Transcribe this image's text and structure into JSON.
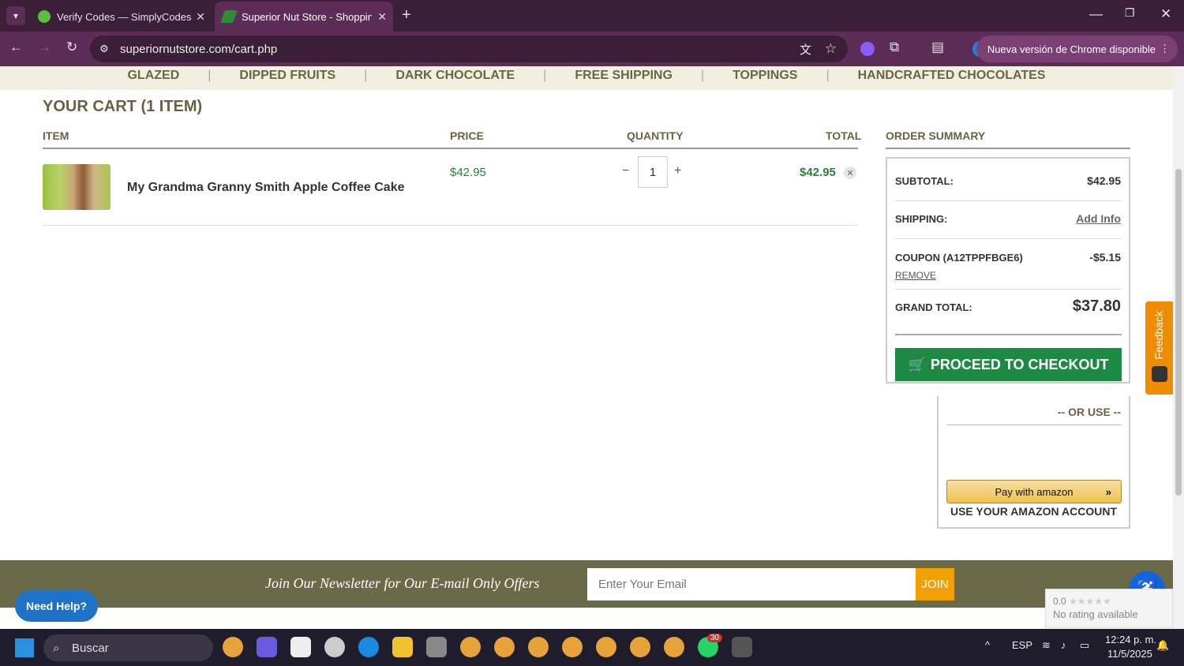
{
  "browser": {
    "tabs": [
      {
        "title": "Verify Codes — SimplyCodes",
        "active": false
      },
      {
        "title": "Superior Nut Store - Shopping C",
        "active": true
      }
    ],
    "url": "superiornutstore.com/cart.php",
    "update_label": "Nueva versión de Chrome disponible"
  },
  "nav": {
    "categories": [
      "GLAZED",
      "DIPPED FRUITS",
      "DARK CHOCOLATE",
      "FREE SHIPPING",
      "TOPPINGS",
      "HANDCRAFTED CHOCOLATES"
    ]
  },
  "cart": {
    "title": "YOUR CART (1 ITEM)",
    "headers": {
      "item": "ITEM",
      "price": "PRICE",
      "quantity": "QUANTITY",
      "total": "TOTAL"
    },
    "items": [
      {
        "name": "My Grandma Granny Smith Apple Coffee Cake",
        "price": "$42.95",
        "quantity": "1",
        "total": "$42.95"
      }
    ]
  },
  "summary": {
    "title": "ORDER SUMMARY",
    "subtotal_label": "SUBTOTAL:",
    "subtotal_value": "$42.95",
    "shipping_label": "SHIPPING:",
    "shipping_value": "Add Info",
    "coupon_label": "COUPON (A12TPPFBGE6)",
    "coupon_value": "-$5.15",
    "coupon_remove": "REMOVE",
    "grand_total_label": "GRAND TOTAL:",
    "grand_total_value": "$37.80",
    "checkout_label": "PROCEED TO CHECKOUT",
    "or_use": "-- OR USE --",
    "amazon_label": "Pay with amazon",
    "amazon_account": "USE YOUR AMAZON ACCOUNT"
  },
  "feedback_label": "Feedback",
  "newsletter": {
    "text": "Join Our Newsletter for Our E-mail Only Offers",
    "placeholder": "Enter Your Email",
    "join": "JOIN"
  },
  "help_label": "Need Help?",
  "rating": {
    "score": "0.0",
    "text": "No rating available"
  },
  "taskbar": {
    "search": "Buscar",
    "lang": "ESP",
    "time": "12:24 p. m.",
    "date": "11/5/2025",
    "whatsapp_badge": "30"
  },
  "colors": {
    "brand_green": "#1d8a44",
    "price_green": "#2f7d3a",
    "nav_tan": "#f3efe0",
    "newsletter_bg": "#6b6a48"
  }
}
